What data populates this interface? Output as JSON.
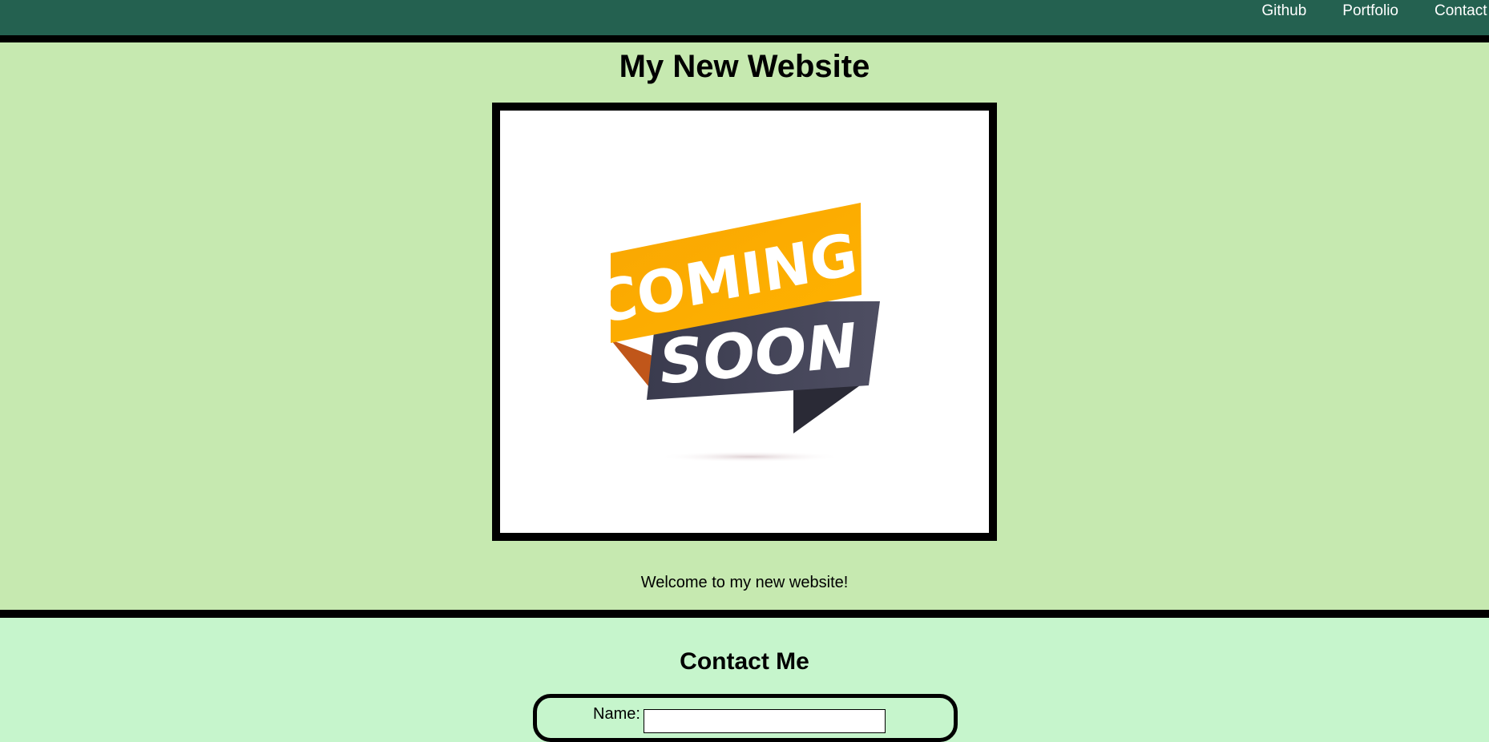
{
  "nav": {
    "links": [
      "Github",
      "Portfolio",
      "Contact"
    ]
  },
  "hero": {
    "title": "My New Website",
    "image": {
      "banner_top": "COMING",
      "banner_bottom": "SOON"
    },
    "welcome_text": "Welcome to my new website!"
  },
  "contact": {
    "title": "Contact Me",
    "name_label": "Name:",
    "name_value": ""
  },
  "colors": {
    "nav_bg": "#246150",
    "hero_bg": "#c6e9b0",
    "contact_bg": "#c6f5cc",
    "banner_orange": "#f7a000",
    "banner_dark": "#3f3f53"
  }
}
